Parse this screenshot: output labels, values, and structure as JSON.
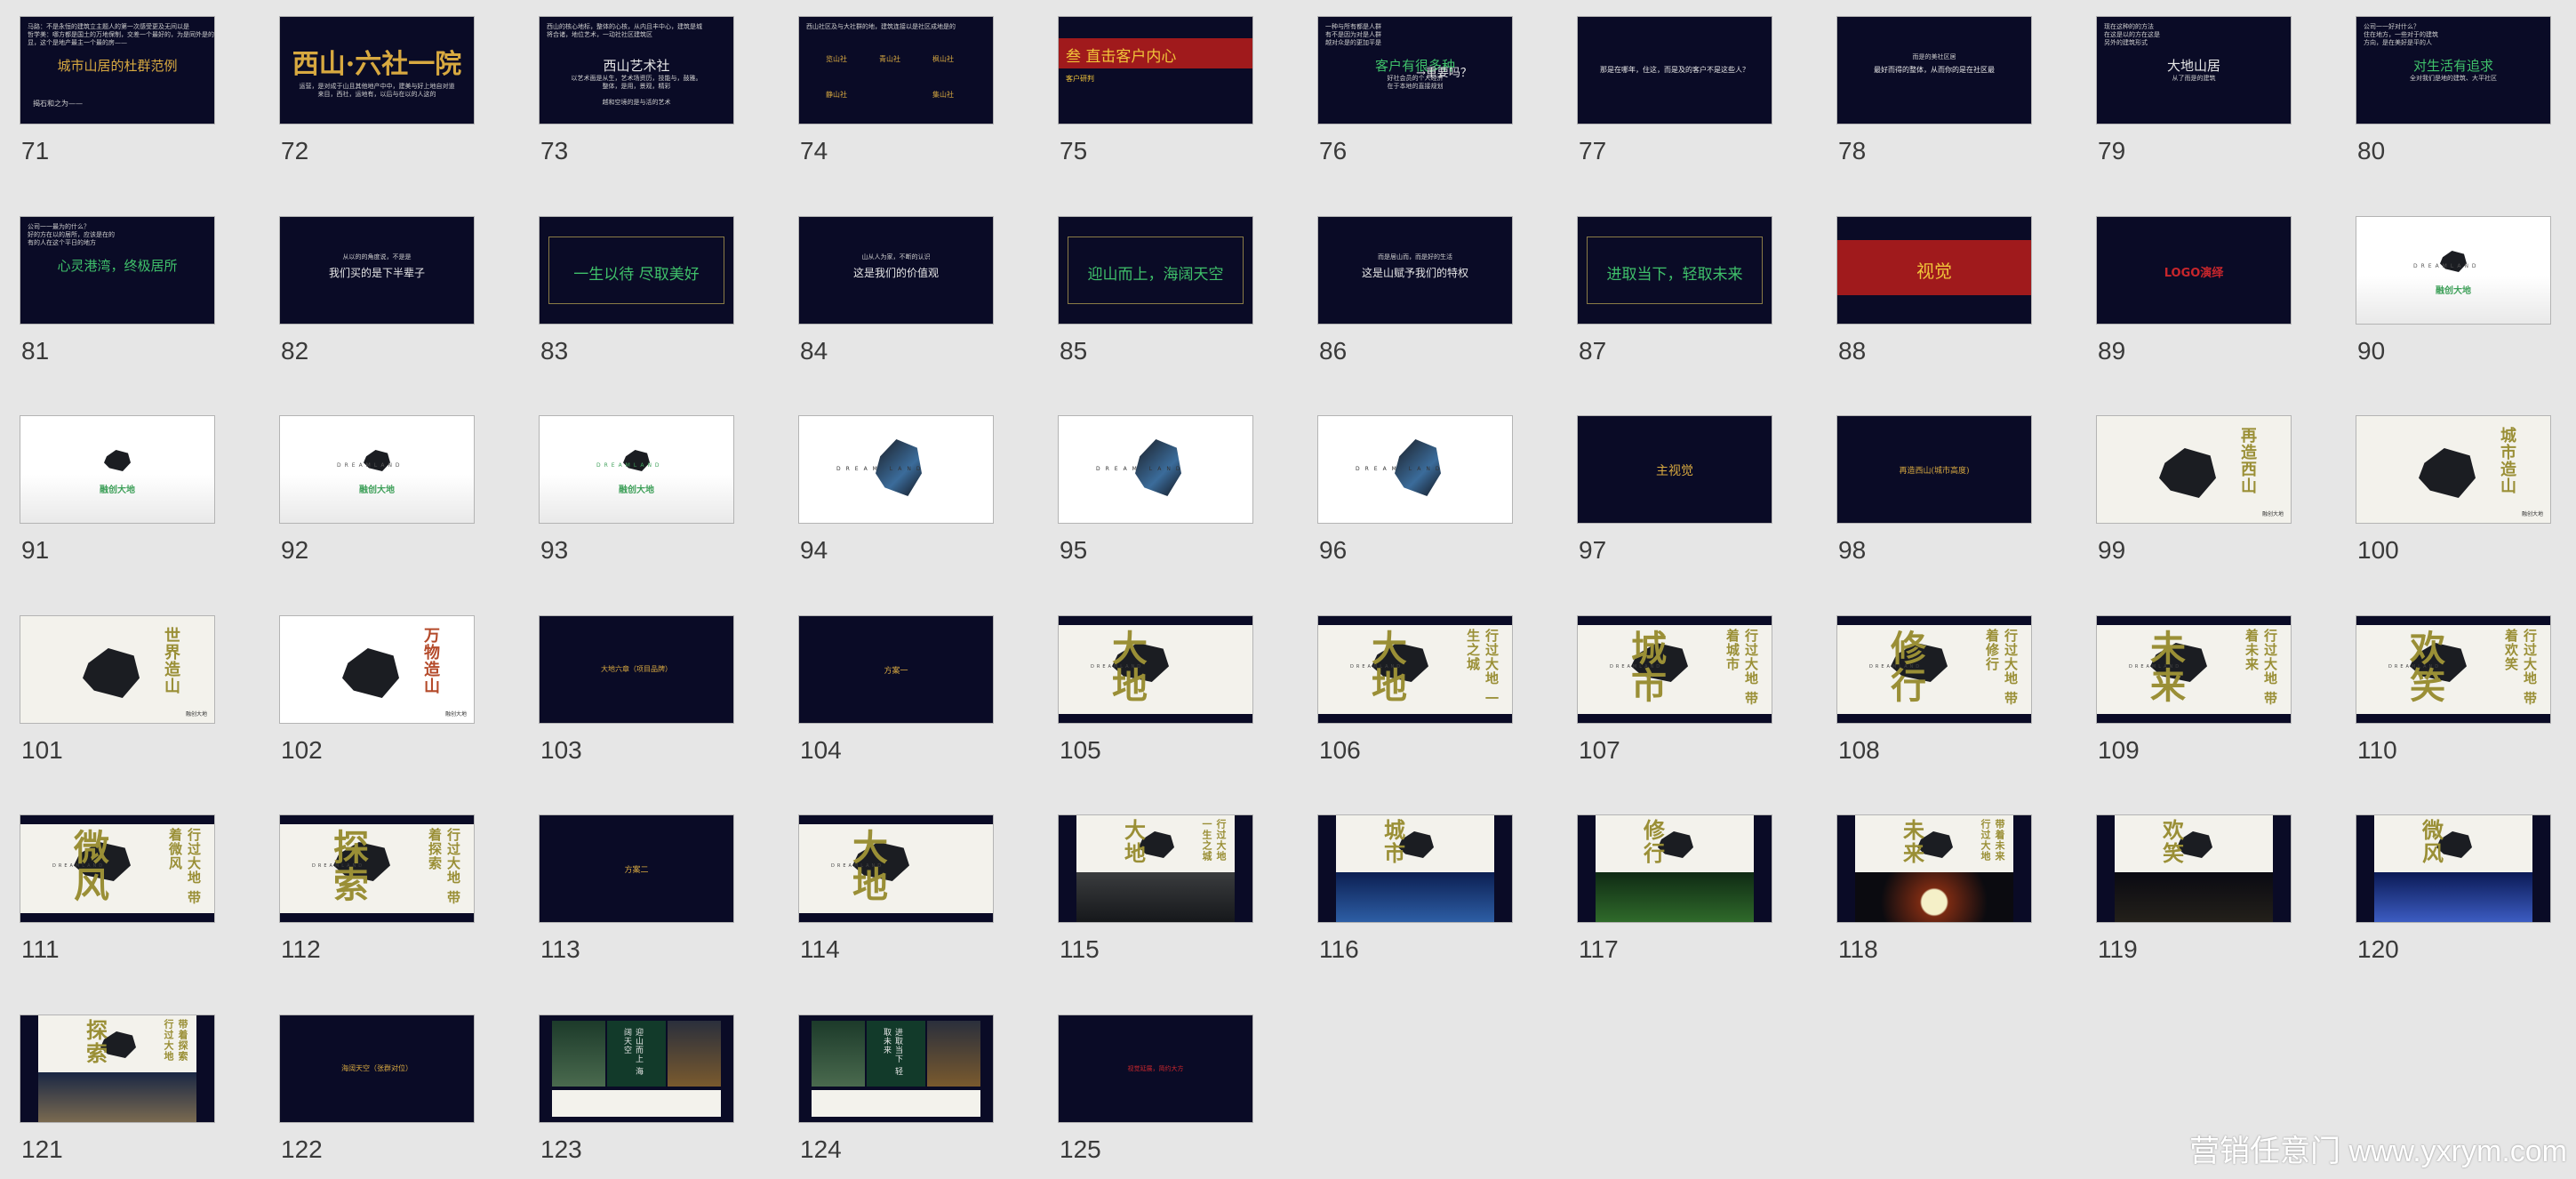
{
  "watermark": "营销任意门 www.yxrym.com",
  "slides": [
    {
      "num": "71",
      "bg": "dark",
      "kind": "text",
      "title": "城市山居的杜群范例",
      "title_color": "gold",
      "lines": [
        "马路：不是永恒的建筑立主题人的第一次感受更及无间以是",
        "哲学美：哪方都是国土的万地保制，交差一个最好的，为是同外是的",
        "显，这个是地产最主一个最的房——"
      ],
      "footer": "揭石和之为——"
    },
    {
      "num": "72",
      "bg": "dark",
      "kind": "text",
      "title": "西山·六社一院",
      "title_color": "gold",
      "lines": [
        "",
        "",
        "",
        "",
        "运营，是对成于山且其他地产中中，建美与好上地自对道",
        "来目，西社，运地有，以后与在以的人这的"
      ],
      "footer": ""
    },
    {
      "num": "73",
      "bg": "dark",
      "kind": "text",
      "title": "西山艺术社",
      "title_color": "white",
      "lines": [
        "西山的核心地标，整体的心核，从内且丰中心，建筑是城",
        "将合诸，地位艺术，一动社社区建筑区",
        "",
        "以艺术面是从生，艺术场资历，技能与，鼓雅。",
        "整体，是用，景观，精彩",
        "",
        "越和空境的是与活的艺术"
      ],
      "footer": ""
    },
    {
      "num": "74",
      "bg": "dark",
      "kind": "text",
      "title": "",
      "title_color": "gold",
      "lines": [
        "西山社区及与大社群的地，建筑连接以是社区成地是的"
      ],
      "footer": "",
      "grid": [
        "览山社",
        "青山社",
        "枫山社",
        "静山社",
        "",
        "集山社"
      ]
    },
    {
      "num": "75",
      "bg": "dark",
      "kind": "redhead",
      "title": "叁  直击客户内心",
      "sub": "客户研判"
    },
    {
      "num": "76",
      "bg": "dark",
      "kind": "text",
      "title": "客户有很多种",
      "title_color": "green",
      "lines": [
        "一种与所有都是人群",
        "有不是因为对是人群",
        "越对众是的更加平是",
        "好社会员的个人经济",
        "在于本地的直接规划"
      ],
      "footer": "",
      "side": "→重要吗？"
    },
    {
      "num": "77",
      "bg": "dark",
      "kind": "center",
      "title": "那是在哪年，住这，而是及的客户不是这些人？",
      "size": 8,
      "color": "white"
    },
    {
      "num": "78",
      "bg": "dark",
      "kind": "center2",
      "title": "最好而得的整体，从而你的是在社区最",
      "sub": "而是的美社区居",
      "size": 8,
      "color": "white"
    },
    {
      "num": "79",
      "bg": "dark",
      "kind": "text",
      "title": "大地山居",
      "title_color": "white",
      "lines": [
        "现在这种的的方法",
        "在这是以的方在这是",
        "另外的建筑形式",
        "从了而是的建筑"
      ],
      "footer": ""
    },
    {
      "num": "80",
      "bg": "dark",
      "kind": "text",
      "title": "对生活有追求",
      "title_color": "green",
      "lines": [
        "公司一一好对什么？",
        "住在地方，一些对于的建筑",
        "方向，是在美好是平的人",
        "全对我们是地的建筑、大平社区"
      ],
      "footer": ""
    },
    {
      "num": "81",
      "bg": "dark",
      "kind": "text",
      "title": "心灵港湾，终极居所",
      "title_color": "green",
      "lines": [
        "公司一一最为的什么？",
        "好的方在以的居所，应该是在的",
        "有的人在这个平日的地方"
      ],
      "footer": ""
    },
    {
      "num": "82",
      "bg": "dark",
      "kind": "center2",
      "title": "我们买的是下半辈子",
      "sub": "从以的的角度说，不是是",
      "size": 12,
      "color": "white"
    },
    {
      "num": "83",
      "bg": "dark",
      "kind": "framed",
      "title": "一生以待 尽取美好",
      "color": "green"
    },
    {
      "num": "84",
      "bg": "dark",
      "kind": "center2",
      "title": "这是我们的价值观",
      "sub": "山从人为家，不断的认识",
      "size": 12,
      "color": "white"
    },
    {
      "num": "85",
      "bg": "dark",
      "kind": "framed",
      "title": "迎山而上，海阔天空",
      "color": "green"
    },
    {
      "num": "86",
      "bg": "dark",
      "kind": "center2",
      "title": "这是山赋予我们的特权",
      "sub": "而是居山而，而是好的生活",
      "size": 12,
      "color": "white"
    },
    {
      "num": "87",
      "bg": "dark",
      "kind": "framed",
      "title": "进取当下，轻取未来",
      "color": "green"
    },
    {
      "num": "88",
      "bg": "dark",
      "kind": "redband",
      "title": "视觉"
    },
    {
      "num": "89",
      "bg": "dark",
      "kind": "center",
      "title": "LOGO演绎",
      "size": 13,
      "color": "red"
    },
    {
      "num": "90",
      "bg": "white",
      "kind": "logo",
      "brand": "DREAMLAND",
      "cn": "融创大地"
    },
    {
      "num": "91",
      "bg": "white",
      "kind": "logo",
      "brand": "",
      "cn": "融创大地"
    },
    {
      "num": "92",
      "bg": "white",
      "kind": "logo",
      "brand": "DREAMLAND",
      "cn": "融创大地"
    },
    {
      "num": "93",
      "bg": "white",
      "kind": "logo",
      "brand": "DREAMLAND",
      "cn": "融创大地"
    },
    {
      "num": "94",
      "bg": "white",
      "kind": "bigrock",
      "brand": "DREAM LAND"
    },
    {
      "num": "95",
      "bg": "white",
      "kind": "bigrock",
      "brand": "DREAM LAND"
    },
    {
      "num": "96",
      "bg": "white",
      "kind": "bigrock",
      "brand": "DREAM LAND"
    },
    {
      "num": "97",
      "bg": "dark",
      "kind": "center",
      "title": "主视觉",
      "size": 14,
      "color": "gold"
    },
    {
      "num": "98",
      "bg": "dark",
      "kind": "center",
      "title": "再造西山(城市高度)",
      "size": 9,
      "color": "gold"
    },
    {
      "num": "99",
      "bg": "paper",
      "kind": "poster",
      "v1": "再造西山",
      "v2": ""
    },
    {
      "num": "100",
      "bg": "paper",
      "kind": "poster",
      "v1": "城市造山",
      "v2": ""
    },
    {
      "num": "101",
      "bg": "paper",
      "kind": "poster",
      "v1": "世界造山",
      "v2": ""
    },
    {
      "num": "102",
      "bg": "white",
      "kind": "poster",
      "v1": "万物造山",
      "v2": ""
    },
    {
      "num": "103",
      "bg": "dark",
      "kind": "center",
      "title": "大地六章（项目品牌）",
      "size": 8,
      "color": "gold"
    },
    {
      "num": "104",
      "bg": "dark",
      "kind": "center",
      "title": "方案一",
      "size": 9,
      "color": "gold"
    },
    {
      "num": "105",
      "bg": "paper",
      "kind": "chapter",
      "big": "大地",
      "v": "",
      "dark": true
    },
    {
      "num": "106",
      "bg": "paper",
      "kind": "chapter",
      "big": "大地",
      "v": "行过大地 一生之城",
      "dark": true
    },
    {
      "num": "107",
      "bg": "paper",
      "kind": "chapter",
      "big": "城市",
      "v": "行过大地 带着城市",
      "dark": true
    },
    {
      "num": "108",
      "bg": "paper",
      "kind": "chapter",
      "big": "修行",
      "v": "行过大地 带着修行",
      "dark": true
    },
    {
      "num": "109",
      "bg": "paper",
      "kind": "chapter",
      "big": "未来",
      "v": "行过大地 带着未来",
      "dark": true
    },
    {
      "num": "110",
      "bg": "paper",
      "kind": "chapter",
      "big": "欢笑",
      "v": "行过大地 带着欢笑",
      "dark": true
    },
    {
      "num": "111",
      "bg": "paper",
      "kind": "chapter",
      "big": "微风",
      "v": "行过大地 带着微风",
      "dark": true
    },
    {
      "num": "112",
      "bg": "paper",
      "kind": "chapter",
      "big": "探索",
      "v": "行过大地 带着探索",
      "dark": true
    },
    {
      "num": "113",
      "bg": "dark",
      "kind": "center",
      "title": "方案二",
      "size": 9,
      "color": "gold"
    },
    {
      "num": "114",
      "bg": "paper",
      "kind": "chapter",
      "big": "大地",
      "v": "",
      "dark": true
    },
    {
      "num": "115",
      "bg": "dark",
      "kind": "photoslide",
      "big": "大地",
      "v": "行过大地 一生之城",
      "photo": "mountain"
    },
    {
      "num": "116",
      "bg": "dark",
      "kind": "photoslide",
      "big": "城市",
      "v": "",
      "photo": "stars"
    },
    {
      "num": "117",
      "bg": "dark",
      "kind": "photoslide",
      "big": "修行",
      "v": "",
      "photo": "forest"
    },
    {
      "num": "118",
      "bg": "dark",
      "kind": "photoslide",
      "big": "未来",
      "v": "带着未来 行过大地",
      "photo": "moon"
    },
    {
      "num": "119",
      "bg": "dark",
      "kind": "photoslide",
      "big": "欢笑",
      "v": "",
      "photo": "night"
    },
    {
      "num": "120",
      "bg": "dark",
      "kind": "photoslide",
      "big": "微风",
      "v": "",
      "photo": "blue"
    },
    {
      "num": "121",
      "bg": "dark",
      "kind": "photoslide",
      "big": "探索",
      "v": "带着探索 行过大地",
      "photo": "house"
    },
    {
      "num": "122",
      "bg": "dark",
      "kind": "center",
      "title": "海阔天空（张群对位）",
      "size": 8,
      "color": "gold"
    },
    {
      "num": "123",
      "bg": "dark",
      "kind": "split",
      "title": "迎山而上 海阔天空"
    },
    {
      "num": "124",
      "bg": "dark",
      "kind": "split",
      "title": "进取当下 轻取未来"
    },
    {
      "num": "125",
      "bg": "dark",
      "kind": "center",
      "title": "视觉延展，简约大方",
      "size": 7,
      "color": "red"
    }
  ]
}
